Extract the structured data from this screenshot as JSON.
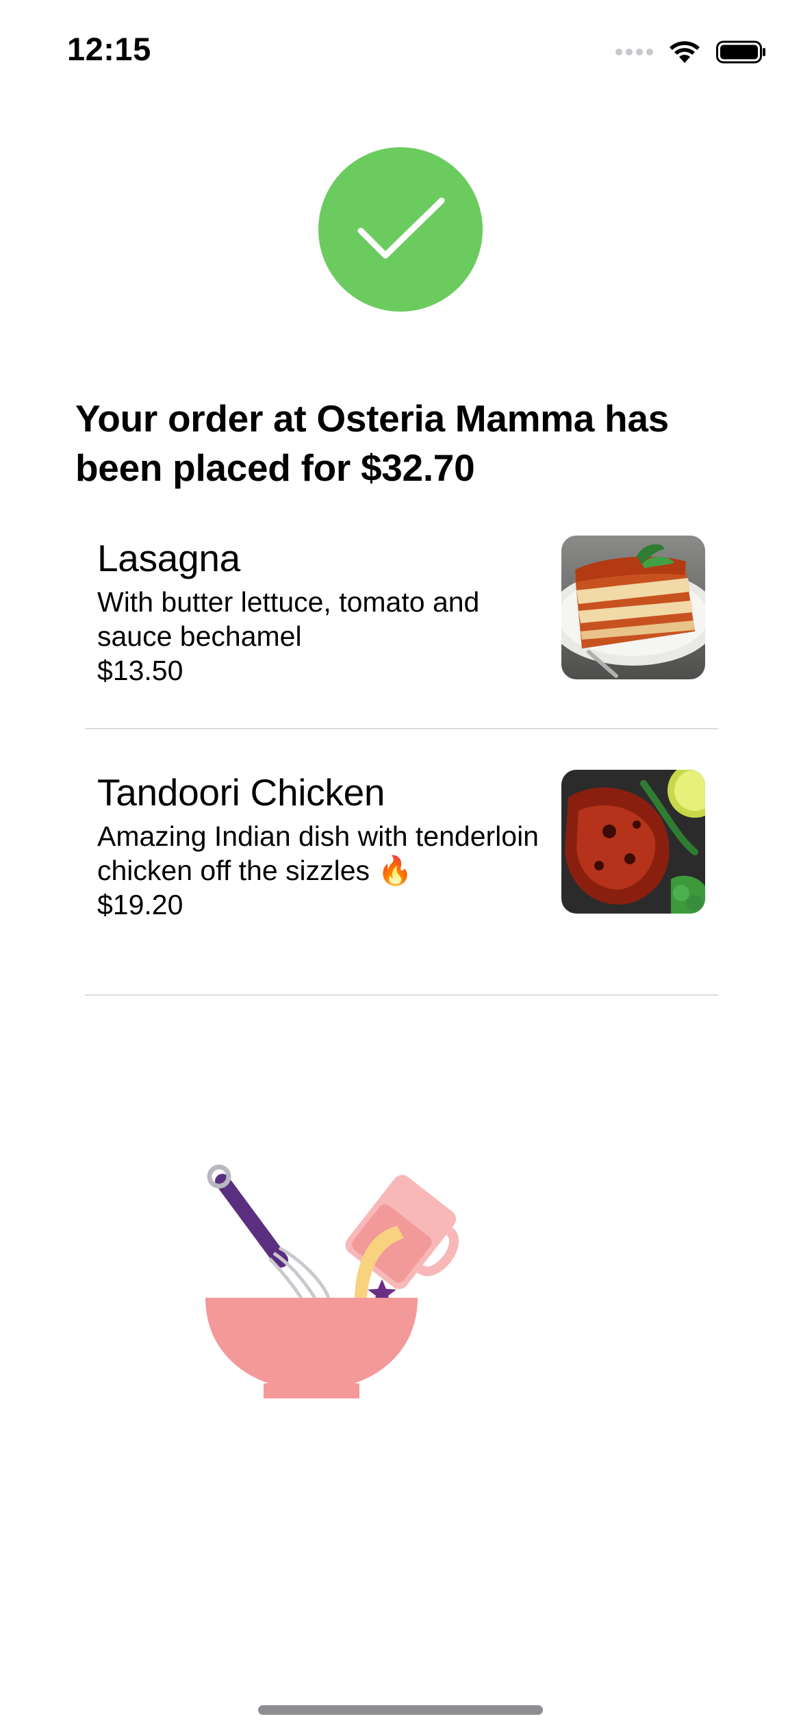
{
  "status_bar": {
    "time": "12:15"
  },
  "confirmation": {
    "heading": "Your order at Osteria Mamma has been placed for $32.70",
    "success_color": "#6ccb5f"
  },
  "order": {
    "items": [
      {
        "name": "Lasagna",
        "description": "With butter lettuce, tomato and sauce bechamel",
        "price": "$13.50",
        "image": "lasagna-photo"
      },
      {
        "name": "Tandoori Chicken",
        "description": "Amazing Indian dish with tenderloin chicken off the sizzles 🔥",
        "price": "$19.20",
        "image": "tandoori-chicken-photo"
      }
    ]
  },
  "illustration": {
    "name": "mixing-bowl-illustration",
    "colors": {
      "bowl": "#f49999",
      "jug": "#f8b8b8",
      "whisk_handle": "#5b2f80",
      "batter": "#f9d27f"
    }
  }
}
